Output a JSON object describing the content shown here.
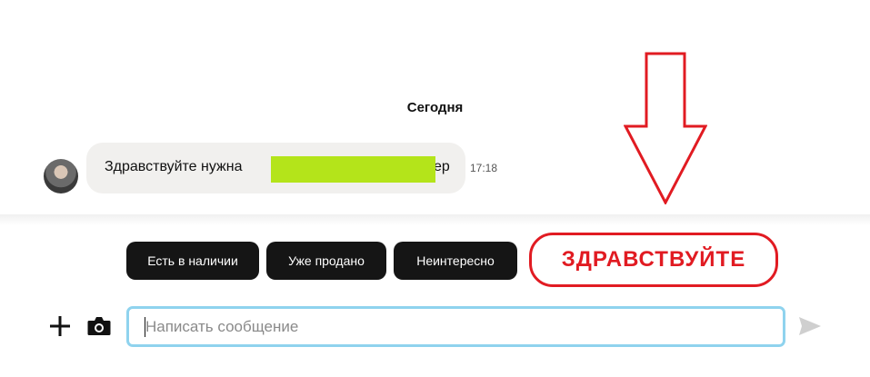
{
  "chat": {
    "date_divider": "Сегодня",
    "message": {
      "text_prefix": "Здравствуйте нужна ",
      "text_suffix": "ер",
      "time": "17:18"
    }
  },
  "quick_replies": [
    "Есть в наличии",
    "Уже продано",
    "Неинтересно"
  ],
  "annotation": {
    "text": "ЗДРАВСТВУЙТЕ",
    "color": "#e11b22"
  },
  "composer": {
    "placeholder": "Написать сообщение",
    "value": ""
  },
  "icons": {
    "add": "plus-icon",
    "camera": "camera-icon",
    "send": "send-icon",
    "annotation_arrow": "down-arrow-icon"
  },
  "colors": {
    "quick_reply_bg": "#151515",
    "input_focus_border": "#8fd3ee",
    "redaction": "#b4e41a"
  }
}
